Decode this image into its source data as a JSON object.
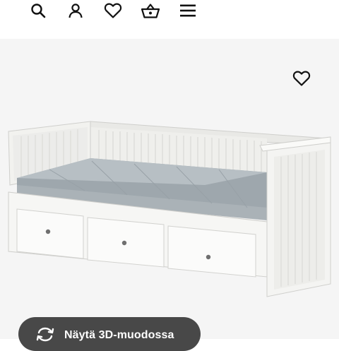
{
  "top_nav": {
    "icons": [
      "search-icon",
      "user-icon",
      "heart-icon",
      "basket-icon",
      "menu-icon"
    ]
  },
  "product": {
    "favorite_icon": "heart-icon",
    "image_subject": "white daybed with three drawers and grey mattress"
  },
  "view_3d_button": {
    "label": "Näytä 3D-muodossa",
    "icon": "rotate-3d-icon",
    "background_color": "#484848"
  },
  "colors": {
    "background": "#ffffff",
    "product_background": "#f5f5f5",
    "icon": "#111111"
  }
}
